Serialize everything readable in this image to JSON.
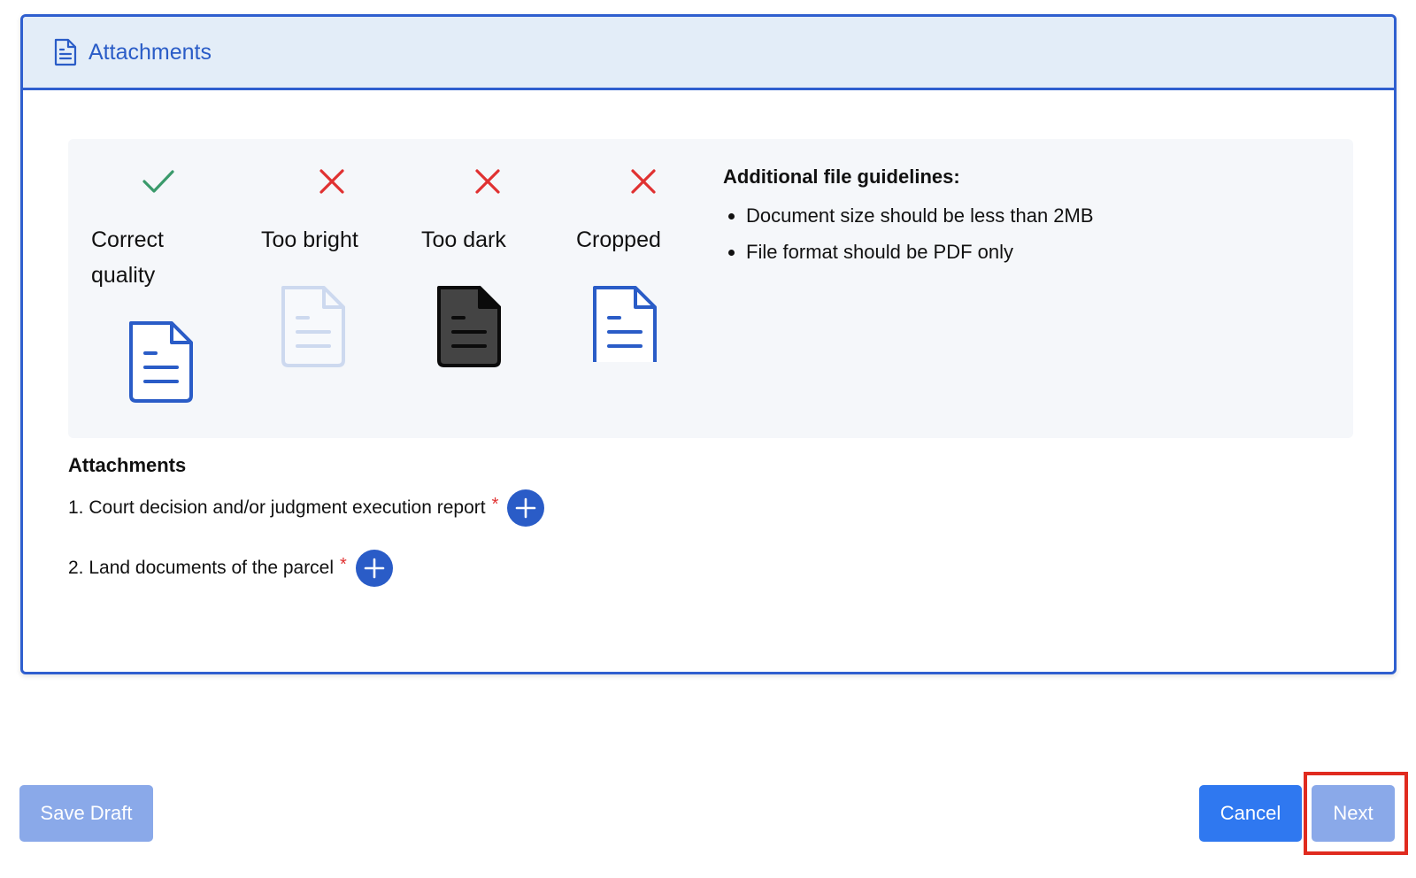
{
  "section": {
    "title": "Attachments",
    "icon": "document-icon"
  },
  "samples": [
    {
      "label_lines": [
        "Correct",
        "quality"
      ],
      "status": "correct",
      "status_icon": "check-icon",
      "doc_style": "normal"
    },
    {
      "label_lines": [
        "Too bright"
      ],
      "status": "incorrect",
      "status_icon": "x-icon",
      "doc_style": "faded"
    },
    {
      "label_lines": [
        "Too dark"
      ],
      "status": "incorrect",
      "status_icon": "x-icon",
      "doc_style": "dark"
    },
    {
      "label_lines": [
        "Cropped"
      ],
      "status": "incorrect",
      "status_icon": "x-icon",
      "doc_style": "cropped"
    }
  ],
  "guidelines": {
    "title": "Additional file guidelines:",
    "items": [
      "Document size should be less than 2MB",
      "File format should be PDF only"
    ]
  },
  "attachments": {
    "title": "Attachments",
    "items": [
      {
        "label": "1. Court decision and/or judgment execution report",
        "required": "*"
      },
      {
        "label": "2. Land documents of the parcel",
        "required": "*"
      }
    ]
  },
  "buttons": {
    "save_draft": "Save Draft",
    "cancel": "Cancel",
    "next": "Next"
  },
  "colors": {
    "primary": "#2a5cc7",
    "border": "#2f5fcf",
    "header_bg": "#e3edf8",
    "check": "#3a9a6b",
    "cross": "#e03131",
    "button_light": "#8aa9e9",
    "button_primary": "#2f78f0",
    "highlight": "#e02b1f"
  }
}
